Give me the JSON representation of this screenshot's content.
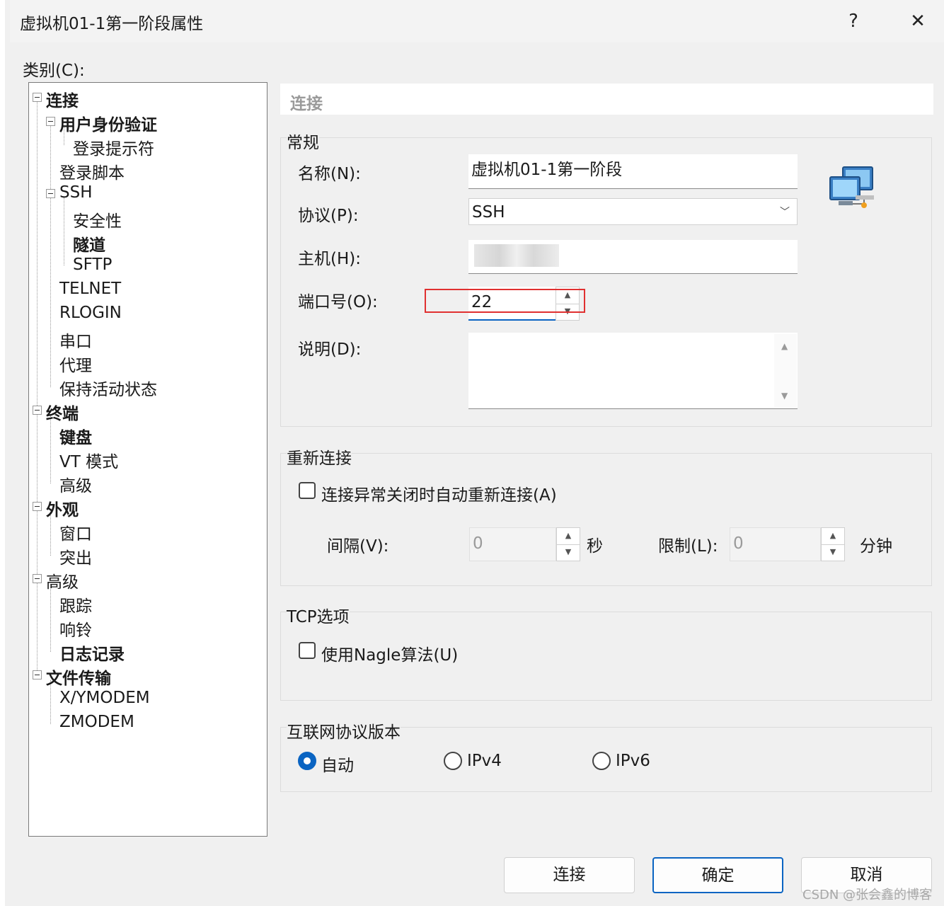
{
  "window": {
    "title": "虚拟机01-1第一阶段属性",
    "help_icon": "?",
    "close_icon": "✕"
  },
  "category_label": "类别(C):",
  "tree": {
    "items": [
      {
        "label": "连接",
        "bold": true
      },
      {
        "label": "用户身份验证",
        "bold": true
      },
      {
        "label": "登录提示符",
        "bold": false
      },
      {
        "label": "登录脚本",
        "bold": false
      },
      {
        "label": "SSH",
        "bold": false
      },
      {
        "label": "安全性",
        "bold": false
      },
      {
        "label": "隧道",
        "bold": true
      },
      {
        "label": "SFTP",
        "bold": false
      },
      {
        "label": "TELNET",
        "bold": false
      },
      {
        "label": "RLOGIN",
        "bold": false
      },
      {
        "label": "串口",
        "bold": false
      },
      {
        "label": "代理",
        "bold": false
      },
      {
        "label": "保持活动状态",
        "bold": false
      },
      {
        "label": "终端",
        "bold": true
      },
      {
        "label": "键盘",
        "bold": true
      },
      {
        "label": "VT 模式",
        "bold": false
      },
      {
        "label": "高级",
        "bold": false
      },
      {
        "label": "外观",
        "bold": true
      },
      {
        "label": "窗口",
        "bold": false
      },
      {
        "label": "突出",
        "bold": false
      },
      {
        "label": "高级",
        "bold": false
      },
      {
        "label": "跟踪",
        "bold": false
      },
      {
        "label": "响铃",
        "bold": false
      },
      {
        "label": "日志记录",
        "bold": true
      },
      {
        "label": "文件传输",
        "bold": true
      },
      {
        "label": "X/YMODEM",
        "bold": false
      },
      {
        "label": "ZMODEM",
        "bold": false
      }
    ]
  },
  "panel": {
    "header": "连接",
    "general": {
      "title": "常规",
      "name_label": "名称(N):",
      "name_value": "虚拟机01-1第一阶段",
      "protocol_label": "协议(P):",
      "protocol_value": "SSH",
      "host_label": "主机(H):",
      "host_value": "",
      "port_label": "端口号(O):",
      "port_value": "22",
      "desc_label": "说明(D):",
      "desc_value": "",
      "icon": "network-computers-icon"
    },
    "reconnect": {
      "title": "重新连接",
      "checkbox_label": "连接异常关闭时自动重新连接(A)",
      "checked": false,
      "interval_label": "间隔(V):",
      "interval_value": "0",
      "interval_unit": "秒",
      "limit_label": "限制(L):",
      "limit_value": "0",
      "limit_unit": "分钟"
    },
    "tcp": {
      "title": "TCP选项",
      "nagle_label": "使用Nagle算法(U)",
      "checked": false
    },
    "ip_version": {
      "title": "互联网协议版本",
      "options": [
        "自动",
        "IPv4",
        "IPv6"
      ],
      "selected": "自动"
    }
  },
  "buttons": {
    "connect": "连接",
    "ok": "确定",
    "cancel": "取消"
  },
  "watermark": "CSDN @张会鑫的博客",
  "colors": {
    "accent": "#0a64c2",
    "highlight_box": "#e03030"
  }
}
